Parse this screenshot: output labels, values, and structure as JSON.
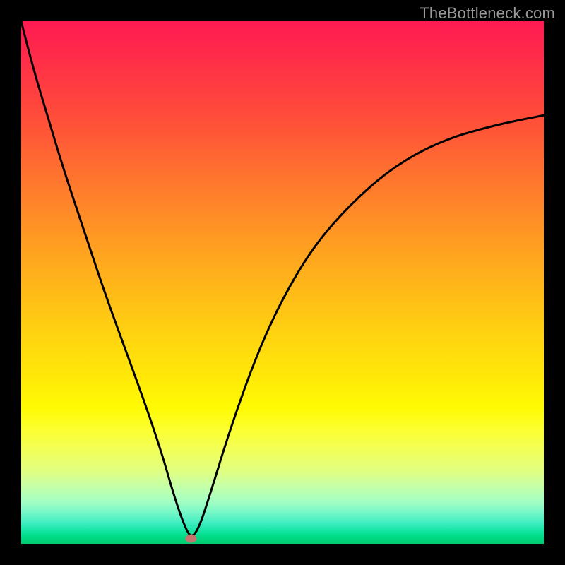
{
  "watermark": "TheBottleneck.com",
  "colors": {
    "page_bg": "#000000",
    "curve": "#000000",
    "vertex_dot": "#c6746e"
  },
  "chart_data": {
    "type": "line",
    "title": "",
    "xlabel": "",
    "ylabel": "",
    "xlim": [
      0,
      100
    ],
    "ylim": [
      0,
      100
    ],
    "grid": false,
    "gradient_stops": [
      {
        "pos": 0,
        "color": "#ff1a52"
      },
      {
        "pos": 20,
        "color": "#ff5238"
      },
      {
        "pos": 40,
        "color": "#ff9524"
      },
      {
        "pos": 60,
        "color": "#ffd310"
      },
      {
        "pos": 75,
        "color": "#fcff2f"
      },
      {
        "pos": 90,
        "color": "#a2ffc4"
      },
      {
        "pos": 100,
        "color": "#01cc6f"
      }
    ],
    "series": [
      {
        "name": "bottleneck-curve",
        "x": [
          0,
          2,
          5,
          8,
          12,
          16,
          20,
          24,
          27,
          29,
          31,
          32.5,
          34,
          36,
          40,
          45,
          50,
          56,
          63,
          71,
          80,
          90,
          100
        ],
        "y": [
          100,
          92,
          82,
          72,
          60,
          48,
          37,
          26,
          17,
          10,
          4,
          1,
          3,
          9,
          22,
          36,
          47,
          57,
          65,
          72,
          77,
          80,
          82
        ]
      }
    ],
    "vertex": {
      "x": 32.5,
      "y": 1,
      "label": ""
    }
  }
}
